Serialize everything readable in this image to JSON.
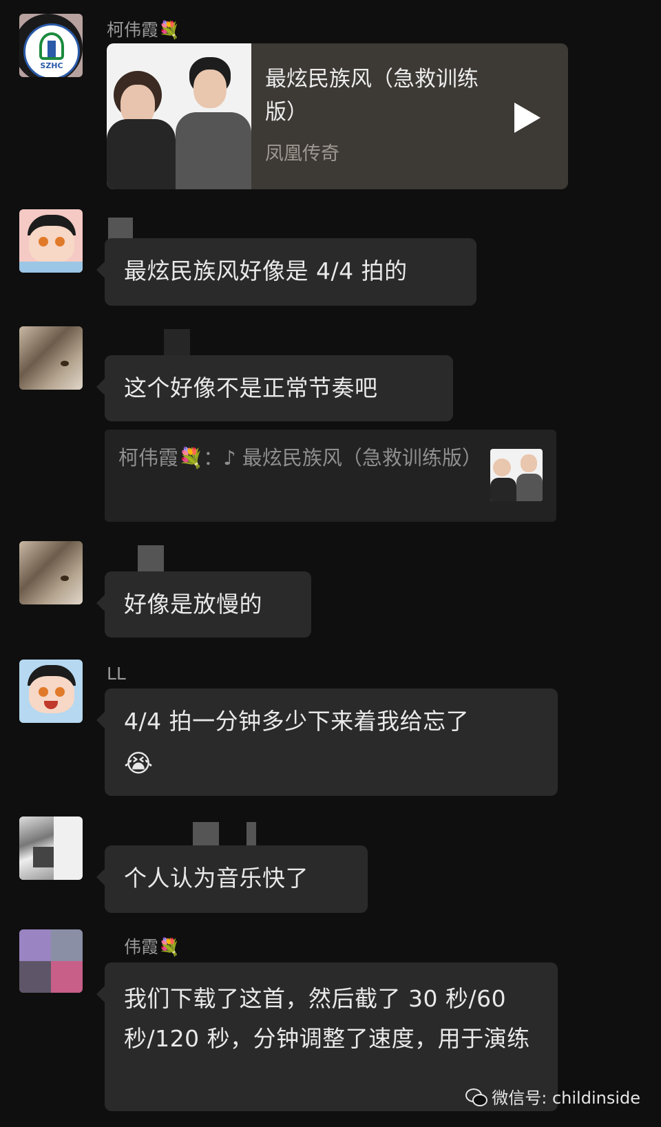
{
  "messages": {
    "m1": {
      "sender": "柯伟霞💐",
      "title": "最炫民族风（急救训练版）",
      "artist": "凤凰传奇"
    },
    "m2": {
      "text": "最炫民族风好像是 4/4 拍的"
    },
    "m3": {
      "text": "这个好像不是正常节奏吧",
      "quote": "柯伟霞💐：♪ 最炫民族风（急救训练版）"
    },
    "m4": {
      "text": "好像是放慢的"
    },
    "m5": {
      "sender": "LL",
      "text": "4/4 拍一分钟多少下来着我给忘了",
      "emoji": "😭"
    },
    "m6": {
      "text": "个人认为音乐快了"
    },
    "m7": {
      "sender": "伟霞💐",
      "text": "我们下载了这首，然后截了 30 秒/60 秒/120 秒，分钟调整了速度，用于演练"
    }
  },
  "logo": {
    "text": "SZHC"
  },
  "watermark": {
    "text": "微信号: childinside"
  },
  "colors": {
    "background": "#0f0f0f",
    "bubble": "#2a2a2a",
    "music_card": "#3d3935"
  }
}
